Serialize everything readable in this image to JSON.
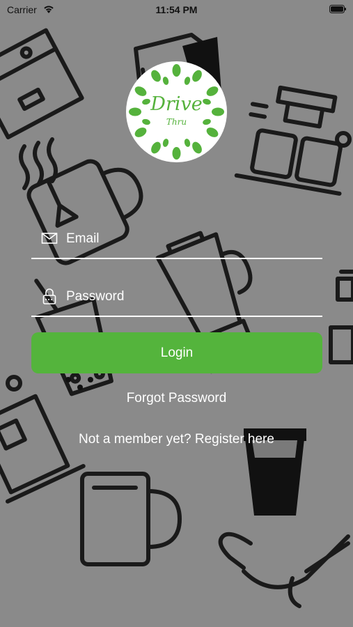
{
  "status_bar": {
    "carrier": "Carrier",
    "time": "11:54 PM"
  },
  "logo": {
    "title": "Drive",
    "subtitle": "Thru",
    "color": "#55b23c"
  },
  "email": {
    "placeholder": "Email",
    "icon": "envelope-icon"
  },
  "password": {
    "placeholder": "Password",
    "icon": "lock-icon"
  },
  "login": {
    "label": "Login",
    "color": "#54b43c"
  },
  "forgot_password": "Forgot Password",
  "register": "Not a member yet? Register here",
  "background": {
    "color": "#8a8a8a",
    "pattern": "coffee-doodle"
  }
}
